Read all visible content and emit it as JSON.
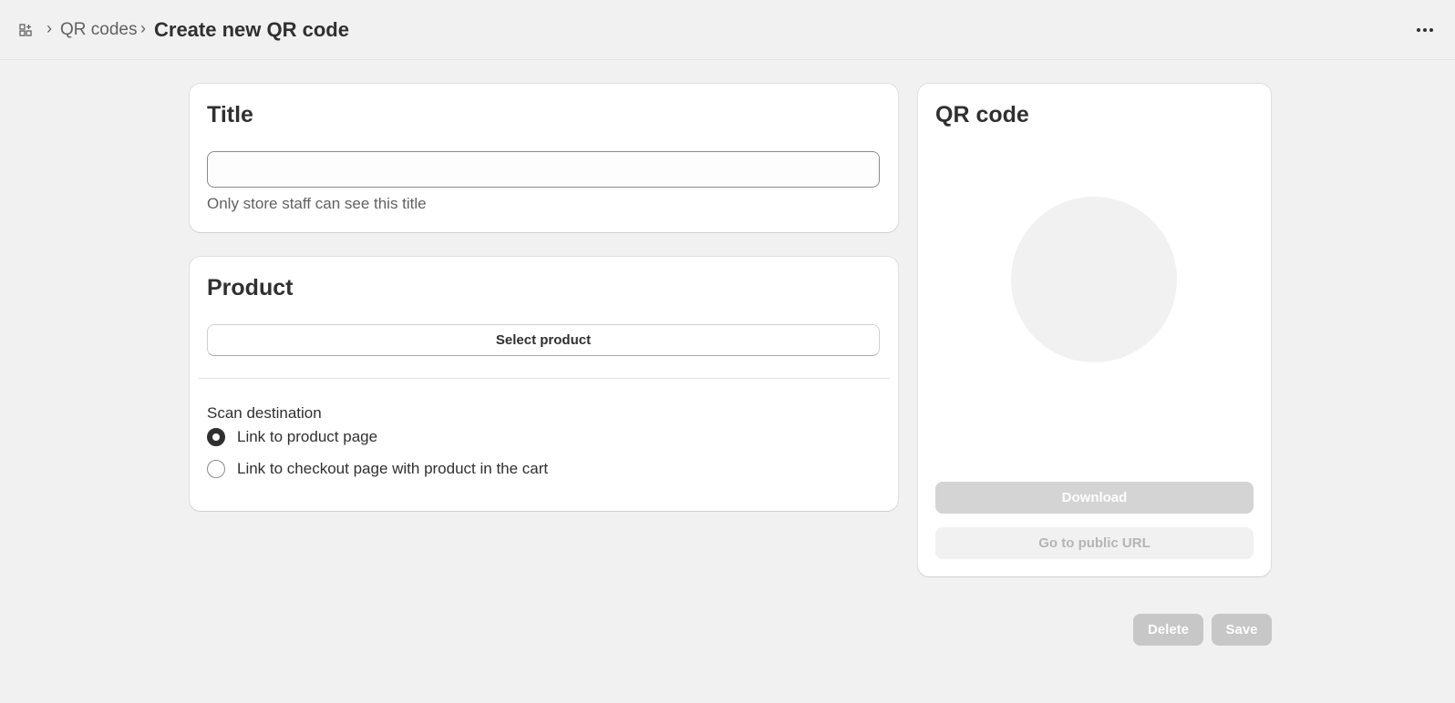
{
  "header": {
    "breadcrumb_link": "QR codes",
    "separator": "›",
    "page_title": "Create new QR code",
    "apps_icon": "apps-icon",
    "more_icon": "more-horizontal-icon"
  },
  "title_card": {
    "heading": "Title",
    "input_value": "",
    "help_text": "Only store staff can see this title"
  },
  "product_card": {
    "heading": "Product",
    "select_button": "Select product",
    "scan_label": "Scan destination",
    "options": [
      {
        "label": "Link to product page",
        "checked": true
      },
      {
        "label": "Link to checkout page with product in the cart",
        "checked": false
      }
    ]
  },
  "qr_card": {
    "heading": "QR code",
    "download_button": "Download",
    "public_url_button": "Go to public URL"
  },
  "footer": {
    "delete_button": "Delete",
    "save_button": "Save"
  },
  "colors": {
    "background": "#f1f1f1",
    "card": "#ffffff",
    "text": "#303030",
    "muted_text": "#616161",
    "disabled_button": "#d4d4d4"
  }
}
